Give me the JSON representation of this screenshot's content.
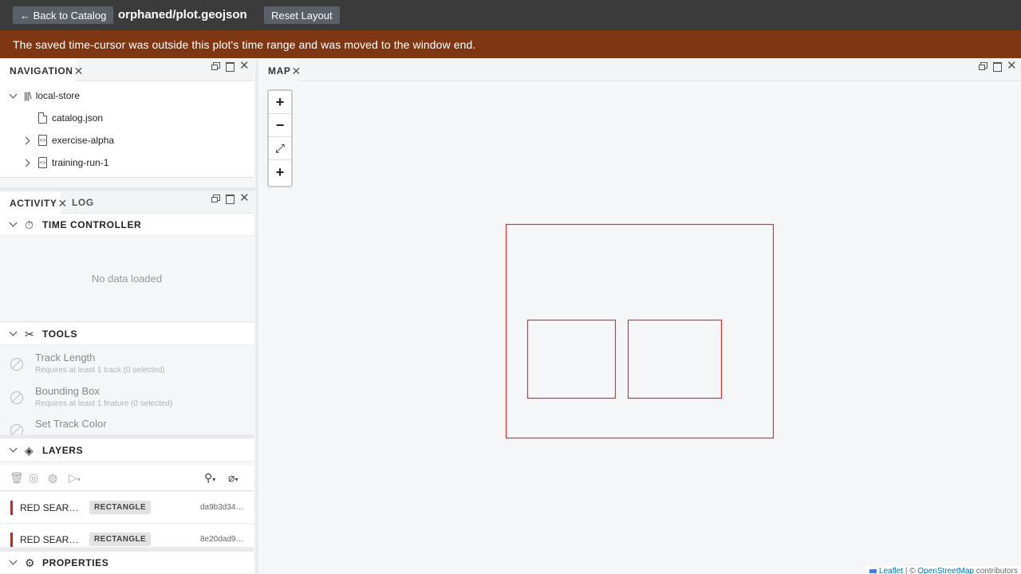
{
  "header": {
    "back_label": "← Back to Catalog",
    "file_title": "orphaned/plot.geojson",
    "reset_label": "Reset Layout"
  },
  "warning": {
    "message": "The saved time-cursor was outside this plot's time range and was moved to the window end."
  },
  "navigation": {
    "tab_label": "NAVIGATION",
    "tree": [
      {
        "label": "local-store",
        "icon": "library-icon",
        "expanded": true
      },
      {
        "label": "catalog.json",
        "icon": "file-icon"
      },
      {
        "label": "exercise-alpha",
        "icon": "code-file-icon",
        "expanded": false
      },
      {
        "label": "training-run-1",
        "icon": "code-file-icon",
        "expanded": false
      }
    ]
  },
  "activity": {
    "tabs": [
      "ACTIVITY",
      "LOG"
    ],
    "time_controller": {
      "title": "TIME CONTROLLER",
      "empty": "No data loaded"
    },
    "tools": {
      "title": "TOOLS",
      "items": [
        {
          "name": "Track Length",
          "desc": "Requires at least 1 track (0 selected)"
        },
        {
          "name": "Bounding Box",
          "desc": "Requires at least 1 feature (0 selected)"
        },
        {
          "name": "Set Track Color",
          "desc": ""
        }
      ]
    },
    "layers": {
      "title": "LAYERS",
      "items": [
        {
          "name": "RED SEAR…",
          "type": "RECTANGLE",
          "id": "da9b3d34…",
          "color": "#d32020"
        },
        {
          "name": "RED SEAR…",
          "type": "RECTANGLE",
          "id": "8e20dad9…",
          "color": "#d32020"
        }
      ]
    },
    "properties": {
      "title": "PROPERTIES"
    }
  },
  "map": {
    "tab_label": "MAP",
    "zoom_in": "+",
    "zoom_out": "−",
    "fit": "⤢",
    "add": "+",
    "attribution_leaflet": "Leaflet",
    "attribution_sep": " | © ",
    "attribution_osm": "OpenStreetMap",
    "attribution_suffix": " contributors",
    "shape_color": "#e03030"
  },
  "colors": {
    "header_bg": "#3b3b3b",
    "warning_bg": "#7f3613",
    "layer_color": "#d32020"
  }
}
